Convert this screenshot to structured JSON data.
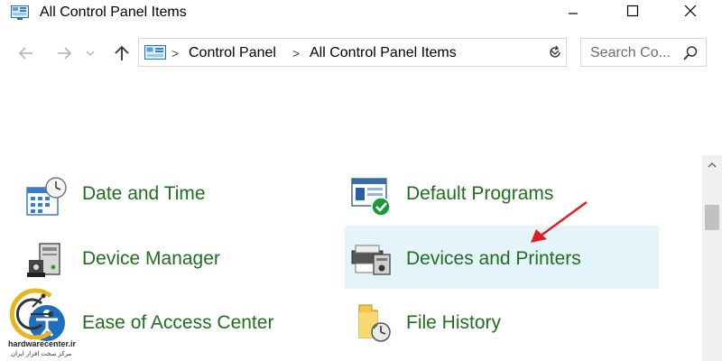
{
  "window": {
    "title": "All Control Panel Items",
    "buttons": [
      "minimize",
      "maximize",
      "close"
    ]
  },
  "navigation": {
    "back_icon": "back-arrow-icon",
    "forward_icon": "forward-arrow-icon",
    "recent_icon": "chevron-down-icon",
    "up_icon": "up-arrow-icon"
  },
  "address": {
    "breadcrumbs": [
      "Control Panel",
      "All Control Panel Items"
    ],
    "separator": ">"
  },
  "search": {
    "placeholder": "Search Co..."
  },
  "items": [
    {
      "label": "Date and Time",
      "icon": "calendar-clock-icon"
    },
    {
      "label": "Default Programs",
      "icon": "default-programs-icon"
    },
    {
      "label": "Device Manager",
      "icon": "device-manager-icon"
    },
    {
      "label": "Devices and Printers",
      "icon": "printer-icon",
      "selected": true
    },
    {
      "label": "Ease of Access Center",
      "icon": "ease-of-access-icon"
    },
    {
      "label": "File History",
      "icon": "file-history-icon"
    }
  ],
  "colors": {
    "link_green": "#1e6f1e",
    "selection": "#e5f3fb",
    "annotation_arrow": "#e02020"
  },
  "watermark": {
    "line1": "hardwarecenter.ir",
    "line2": "مرکز سخت افزار ایران"
  }
}
